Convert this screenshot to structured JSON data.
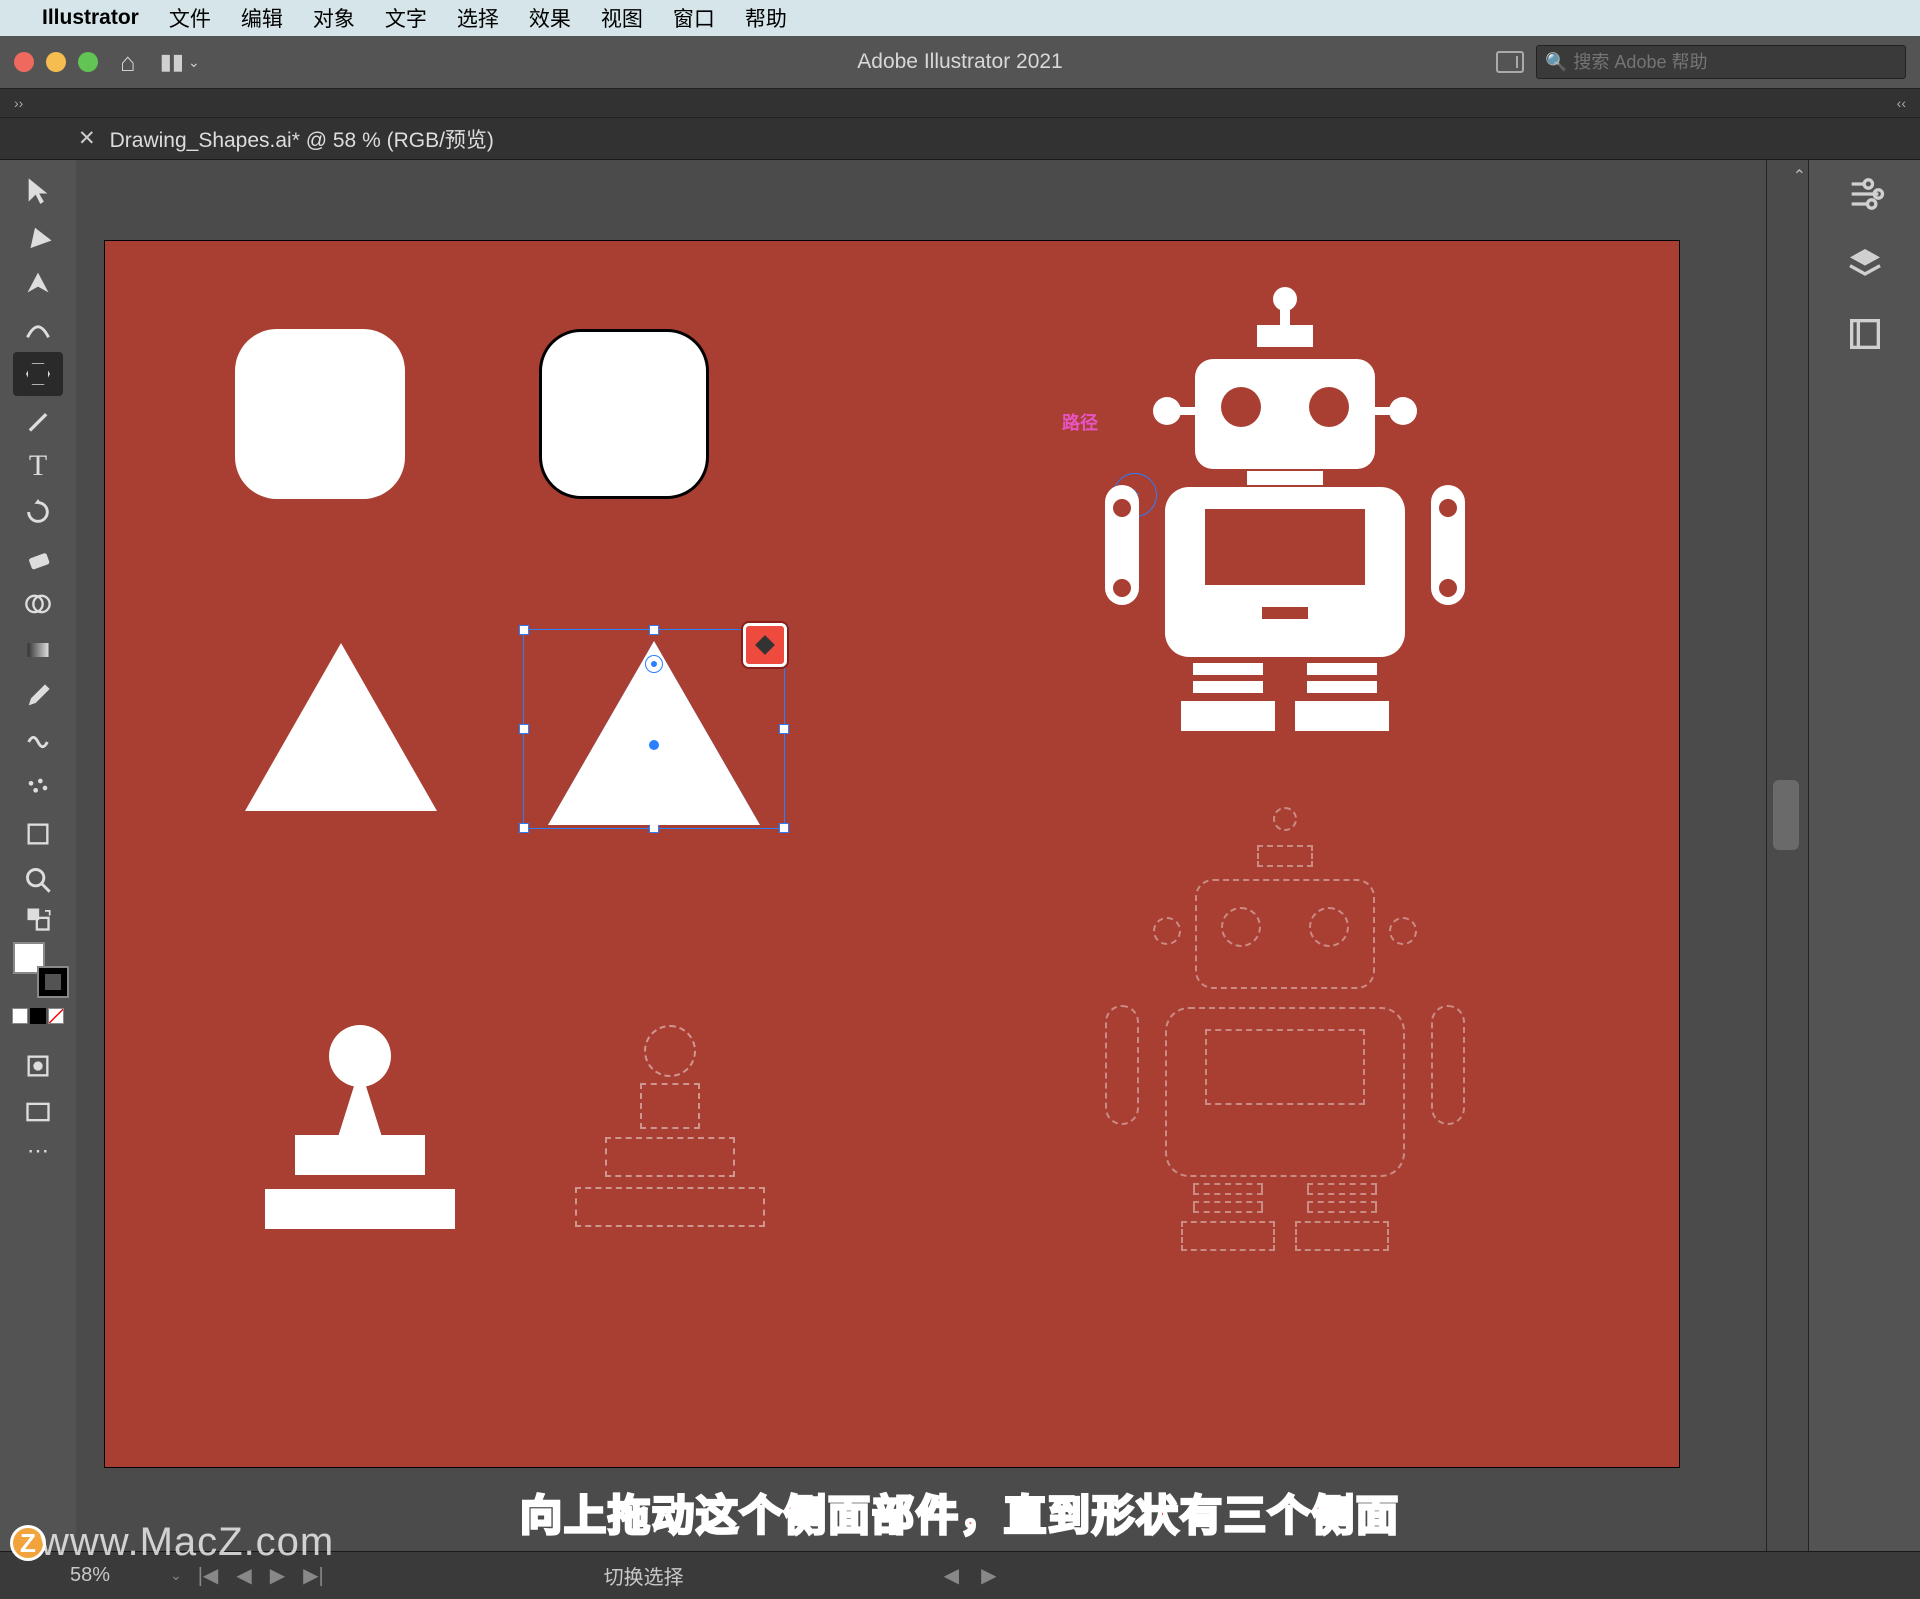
{
  "menubar": {
    "app": "Illustrator",
    "items": [
      "文件",
      "编辑",
      "对象",
      "文字",
      "选择",
      "效果",
      "视图",
      "窗口",
      "帮助"
    ]
  },
  "titlebar": {
    "title": "Adobe Illustrator 2021",
    "search_placeholder": "搜索 Adobe 帮助"
  },
  "document": {
    "tab_label": "Drawing_Shapes.ai* @ 58 % (RGB/预览)"
  },
  "canvas": {
    "path_label": "路径",
    "background": "#a93e33",
    "selection_color": "#2a7fff",
    "side_widget_color": "#ef4a3e"
  },
  "statusbar": {
    "zoom": "58%",
    "label": "切换选择"
  },
  "caption": "向上拖动这个侧面部件，直到形状有三个侧面",
  "watermark": "www.MacZ.com",
  "watermark_badge": "Z",
  "tools": {
    "list": [
      "selection-tool",
      "direct-selection-tool",
      "pen-tool",
      "curvature-tool",
      "polygon-tool",
      "brush-tool",
      "type-tool",
      "rotate-tool",
      "eraser-tool",
      "shape-builder-tool",
      "gradient-tool",
      "eyedropper-tool",
      "warp-tool",
      "symbol-sprayer-tool",
      "artboard-tool",
      "zoom-tool"
    ],
    "selected": "polygon-tool"
  },
  "right_panels": {
    "icons": [
      "properties-icon",
      "layers-icon",
      "libraries-icon"
    ]
  }
}
